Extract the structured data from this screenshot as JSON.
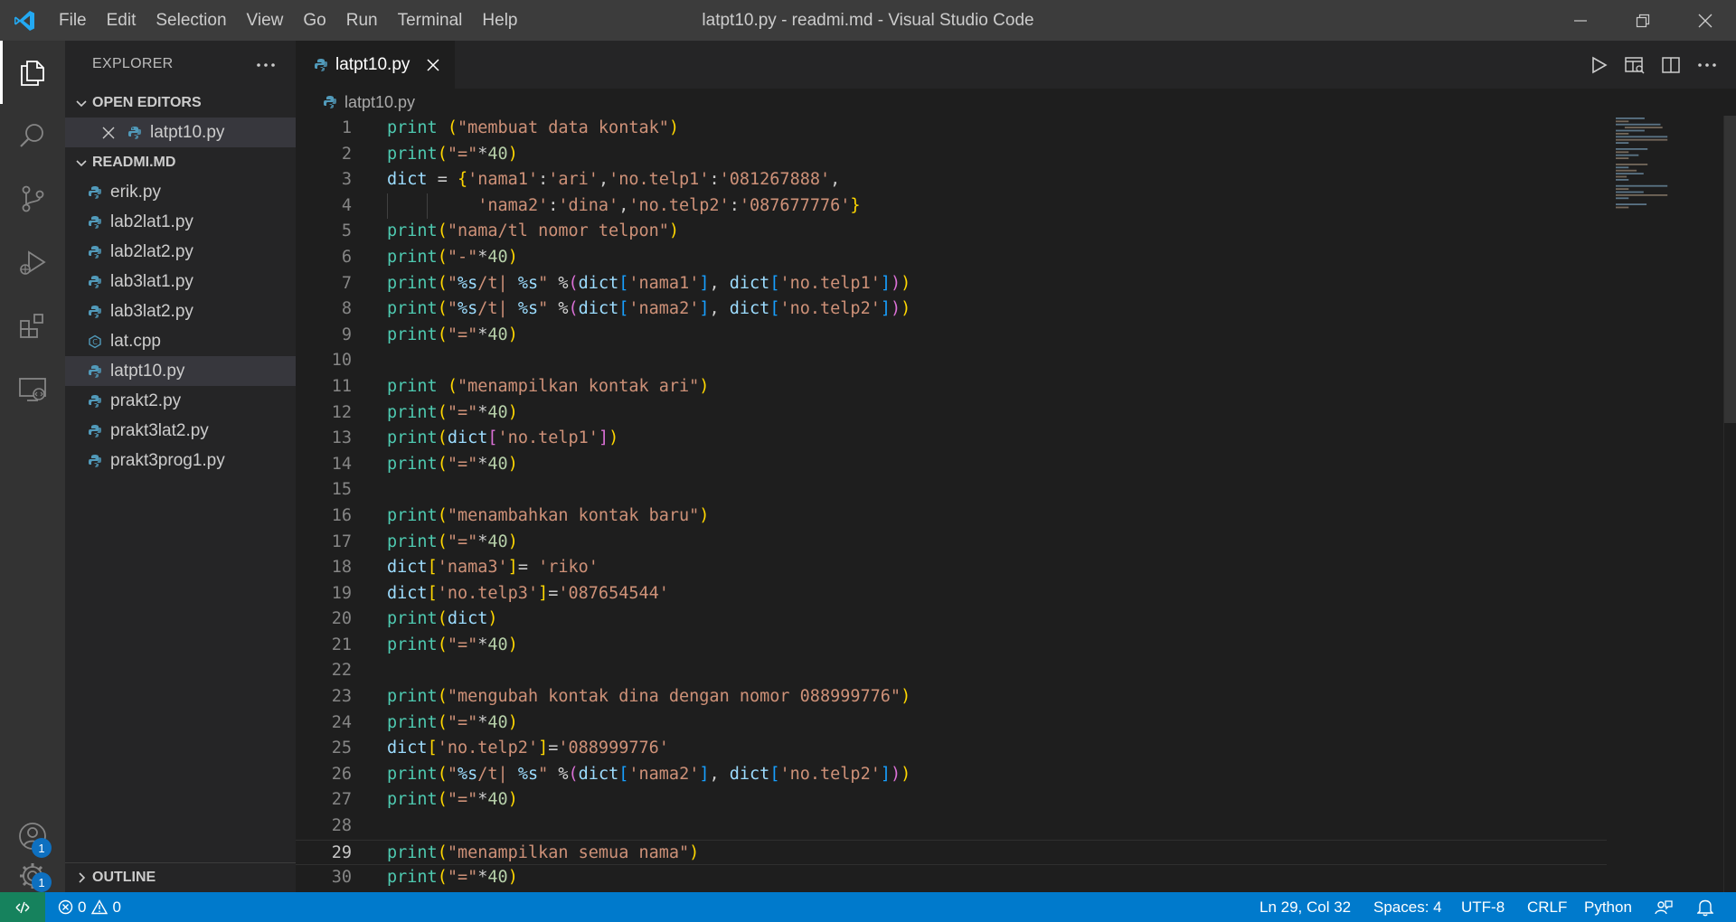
{
  "titlebar": {
    "menu": [
      "File",
      "Edit",
      "Selection",
      "View",
      "Go",
      "Run",
      "Terminal",
      "Help"
    ],
    "window_title": "latpt10.py - readmi.md - Visual Studio Code"
  },
  "activitybar": {
    "accounts_badge": "1",
    "settings_badge": "1"
  },
  "sidebar": {
    "title": "EXPLORER",
    "open_editors": {
      "label": "OPEN EDITORS",
      "items": [
        "latpt10.py"
      ]
    },
    "folder": {
      "label": "READMI.MD",
      "files": [
        "erik.py",
        "lab2lat1.py",
        "lab2lat2.py",
        "lab3lat1.py",
        "lab3lat2.py",
        "lat.cpp",
        "latpt10.py",
        "prakt2.py",
        "prakt3lat2.py",
        "prakt3prog1.py"
      ]
    },
    "outline": "OUTLINE"
  },
  "editor": {
    "tab": "latpt10.py",
    "breadcrumb": "latpt10.py",
    "current_line": 29,
    "lines": [
      "print (\"membuat data kontak\")",
      "print(\"=\"*40)",
      "dict = {'nama1':'ari','no.telp1':'081267888',",
      "         'nama2':'dina','no.telp2':'087677776'}",
      "print(\"nama/tl nomor telpon\")",
      "print(\"-\"*40)",
      "print(\"%s/t| %s\" %(dict['nama1'], dict['no.telp1']))",
      "print(\"%s/t| %s\" %(dict['nama2'], dict['no.telp2']))",
      "print(\"=\"*40)",
      "",
      "print (\"menampilkan kontak ari\")",
      "print(\"=\"*40)",
      "print(dict['no.telp1'])",
      "print(\"=\"*40)",
      "",
      "print(\"menambahkan kontak baru\")",
      "print(\"=\"*40)",
      "dict['nama3']= 'riko'",
      "dict['no.telp3']='087654544'",
      "print(dict)",
      "print(\"=\"*40)",
      "",
      "print(\"mengubah kontak dina dengan nomor 088999776\")",
      "print(\"=\"*40)",
      "dict['no.telp2']='088999776'",
      "print(\"%s/t| %s\" %(dict['nama2'], dict['no.telp2']))",
      "print(\"=\"*40)",
      "",
      "print(\"menampilkan semua nama\")",
      "print(\"=\"*40)"
    ]
  },
  "statusbar": {
    "errors": "0",
    "warnings": "0",
    "position": "Ln 29, Col 32",
    "spaces": "Spaces: 4",
    "encoding": "UTF-8",
    "eol": "CRLF",
    "language": "Python"
  },
  "colors": {
    "accent": "#007acc",
    "remote": "#16825d",
    "keyword": "#569cd6",
    "string": "#ce9178",
    "number": "#b5cea8",
    "builtin": "#4ec9b0"
  }
}
